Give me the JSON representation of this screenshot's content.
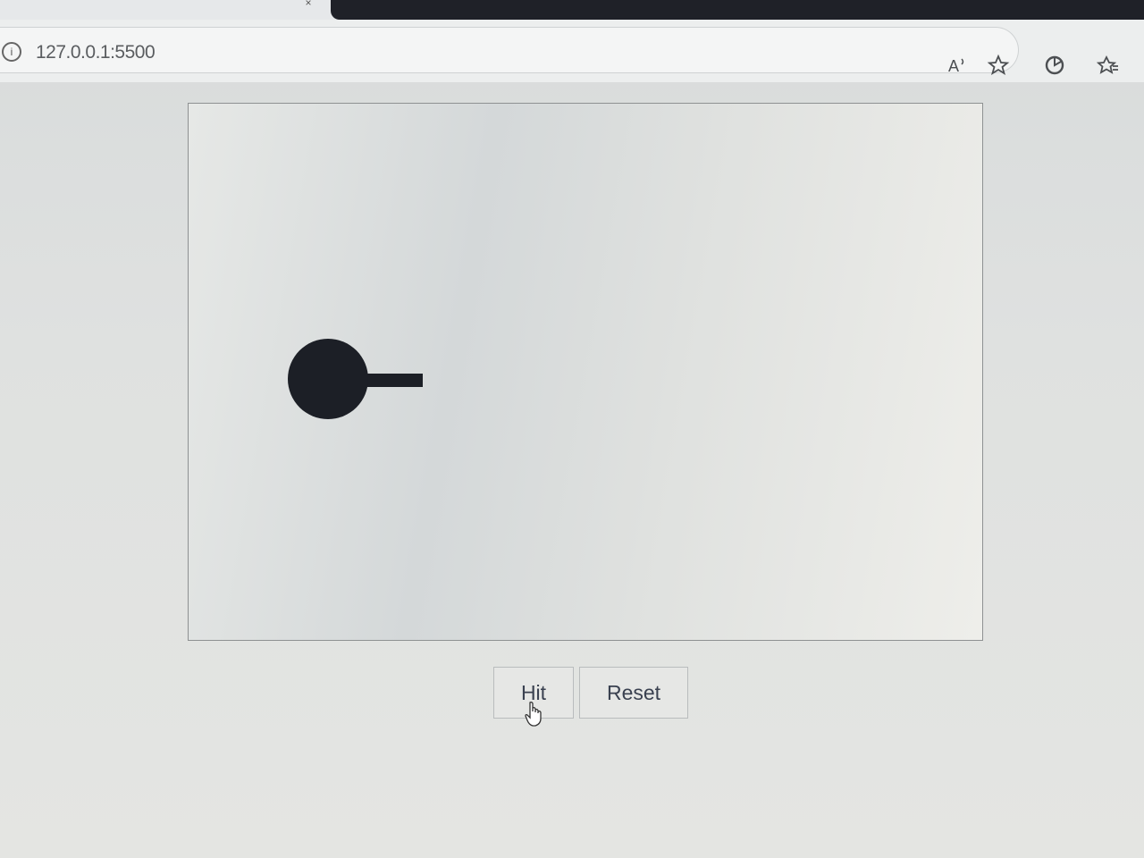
{
  "browser": {
    "url": "127.0.0.1:5500",
    "icons": [
      "site-info-icon",
      "read-aloud-icon",
      "favorite-star-icon",
      "extension-icon",
      "favorites-icon"
    ]
  },
  "game": {
    "ball_color": "#1c1f26",
    "stick_color": "#1c1f26"
  },
  "controls": {
    "hit_label": "Hit",
    "reset_label": "Reset"
  }
}
